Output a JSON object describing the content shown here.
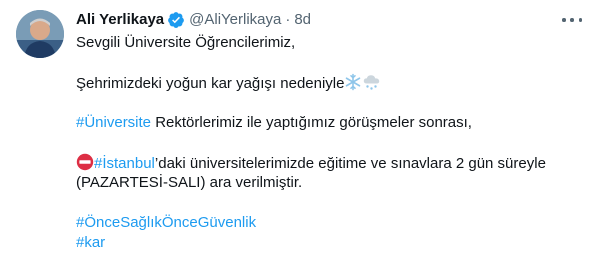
{
  "author": {
    "name": "Ali Yerlikaya",
    "handle": "@AliYerlikaya",
    "separator": "·",
    "time": "8d"
  },
  "tweet": {
    "line1": "Sevgili Üniversite Öğrencilerimiz,",
    "line2": "Şehrimizdeki yoğun kar yağışı nedeniyle",
    "line3_tag": "#Üniversite",
    "line3_text": " Rektörlerimiz ile yaptığımız görüşmeler sonrası,",
    "line4_tag": "#İstanbul",
    "line4_text": "’daki üniversitelerimizde eğitime ve sınavlara  2 gün süreyle",
    "line5": "(PAZARTESİ-SALI) ara verilmiştir.",
    "hashtag1": "#ÖnceSağlıkÖnceGüvenlik",
    "hashtag2": "#kar"
  },
  "icons": {
    "verified": "verified-badge-icon",
    "more": "more-options-icon",
    "snowflake": "snowflake-emoji",
    "snow_cloud": "snow-cloud-emoji",
    "no_entry": "no-entry-emoji"
  },
  "colors": {
    "link": "#1d9bf0",
    "text": "#0f1419",
    "muted": "#536471"
  }
}
